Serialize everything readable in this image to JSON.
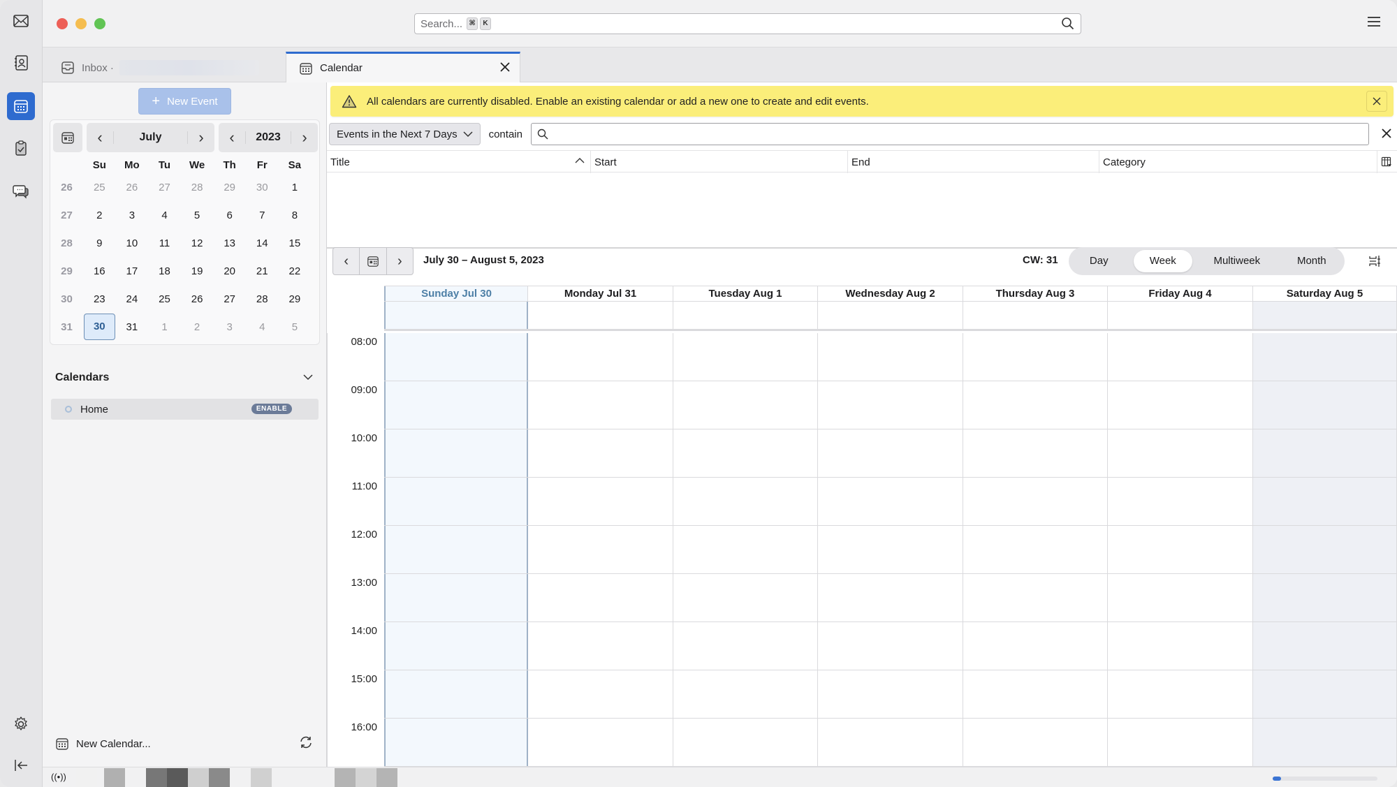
{
  "spaces": [
    {
      "name": "mail",
      "icon": "mail-icon",
      "active": false
    },
    {
      "name": "address-book",
      "icon": "address-book-icon",
      "active": false
    },
    {
      "name": "calendar",
      "icon": "calendar-icon",
      "active": true
    },
    {
      "name": "tasks",
      "icon": "tasks-icon",
      "active": false
    },
    {
      "name": "chat",
      "icon": "chat-icon",
      "active": false
    }
  ],
  "titlebar": {
    "search_placeholder": "Search...",
    "shortcut_keys": [
      "⌘",
      "K"
    ]
  },
  "tabs": [
    {
      "label": "Inbox ·",
      "icon": "inbox-icon",
      "active": false
    },
    {
      "label": "Calendar",
      "icon": "calendar-icon",
      "active": true
    }
  ],
  "sidebar": {
    "new_event_label": "New Event",
    "minical": {
      "month": "July",
      "year": "2023",
      "weekdays": [
        "Su",
        "Mo",
        "Tu",
        "We",
        "Th",
        "Fr",
        "Sa"
      ],
      "weeks": [
        {
          "wk": "26",
          "days": [
            {
              "d": "25",
              "o": true
            },
            {
              "d": "26",
              "o": true
            },
            {
              "d": "27",
              "o": true
            },
            {
              "d": "28",
              "o": true
            },
            {
              "d": "29",
              "o": true
            },
            {
              "d": "30",
              "o": true
            },
            {
              "d": "1"
            }
          ]
        },
        {
          "wk": "27",
          "days": [
            {
              "d": "2"
            },
            {
              "d": "3"
            },
            {
              "d": "4"
            },
            {
              "d": "5"
            },
            {
              "d": "6"
            },
            {
              "d": "7"
            },
            {
              "d": "8"
            }
          ]
        },
        {
          "wk": "28",
          "days": [
            {
              "d": "9"
            },
            {
              "d": "10"
            },
            {
              "d": "11"
            },
            {
              "d": "12"
            },
            {
              "d": "13"
            },
            {
              "d": "14"
            },
            {
              "d": "15"
            }
          ]
        },
        {
          "wk": "29",
          "days": [
            {
              "d": "16"
            },
            {
              "d": "17"
            },
            {
              "d": "18"
            },
            {
              "d": "19"
            },
            {
              "d": "20"
            },
            {
              "d": "21"
            },
            {
              "d": "22"
            }
          ]
        },
        {
          "wk": "30",
          "days": [
            {
              "d": "23"
            },
            {
              "d": "24"
            },
            {
              "d": "25"
            },
            {
              "d": "26"
            },
            {
              "d": "27"
            },
            {
              "d": "28"
            },
            {
              "d": "29"
            }
          ]
        },
        {
          "wk": "31",
          "days": [
            {
              "d": "30",
              "sel": true
            },
            {
              "d": "31"
            },
            {
              "d": "1",
              "o": true
            },
            {
              "d": "2",
              "o": true
            },
            {
              "d": "3",
              "o": true
            },
            {
              "d": "4",
              "o": true
            },
            {
              "d": "5",
              "o": true
            }
          ]
        }
      ]
    },
    "calendars_title": "Calendars",
    "calendars": [
      {
        "name": "Home",
        "badge": "ENABLE"
      }
    ],
    "new_calendar_label": "New Calendar..."
  },
  "notification": {
    "message": "All calendars are currently disabled. Enable an existing calendar or add a new one to create and edit events."
  },
  "filter": {
    "selected": "Events in the Next 7 Days",
    "contain_label": "contain",
    "search_value": ""
  },
  "event_list": {
    "columns": [
      "Title",
      "Start",
      "End",
      "Category"
    ],
    "rows": []
  },
  "week_view": {
    "range": "July 30 – August 5, 2023",
    "cw": "CW: 31",
    "modes": [
      {
        "label": "Day",
        "active": false
      },
      {
        "label": "Week",
        "active": true
      },
      {
        "label": "Multiweek",
        "active": false
      },
      {
        "label": "Month",
        "active": false
      }
    ],
    "days": [
      {
        "label": "Sunday Jul 30",
        "today": true,
        "weekend": false
      },
      {
        "label": "Monday Jul 31",
        "today": false,
        "weekend": false
      },
      {
        "label": "Tuesday Aug 1",
        "today": false,
        "weekend": false
      },
      {
        "label": "Wednesday Aug 2",
        "today": false,
        "weekend": false
      },
      {
        "label": "Thursday Aug 3",
        "today": false,
        "weekend": false
      },
      {
        "label": "Friday Aug 4",
        "today": false,
        "weekend": false
      },
      {
        "label": "Saturday Aug 5",
        "today": false,
        "weekend": true
      }
    ],
    "hours": [
      "08:00",
      "09:00",
      "10:00",
      "11:00",
      "12:00",
      "13:00",
      "14:00",
      "15:00",
      "16:00"
    ]
  },
  "statusbar": {
    "progress_fraction": 0.08,
    "accent": "#3b74d3"
  },
  "colors": {
    "accent": "#2e6bcf",
    "notification_bg": "#fbee7a",
    "today_text": "#4d7fa6"
  }
}
